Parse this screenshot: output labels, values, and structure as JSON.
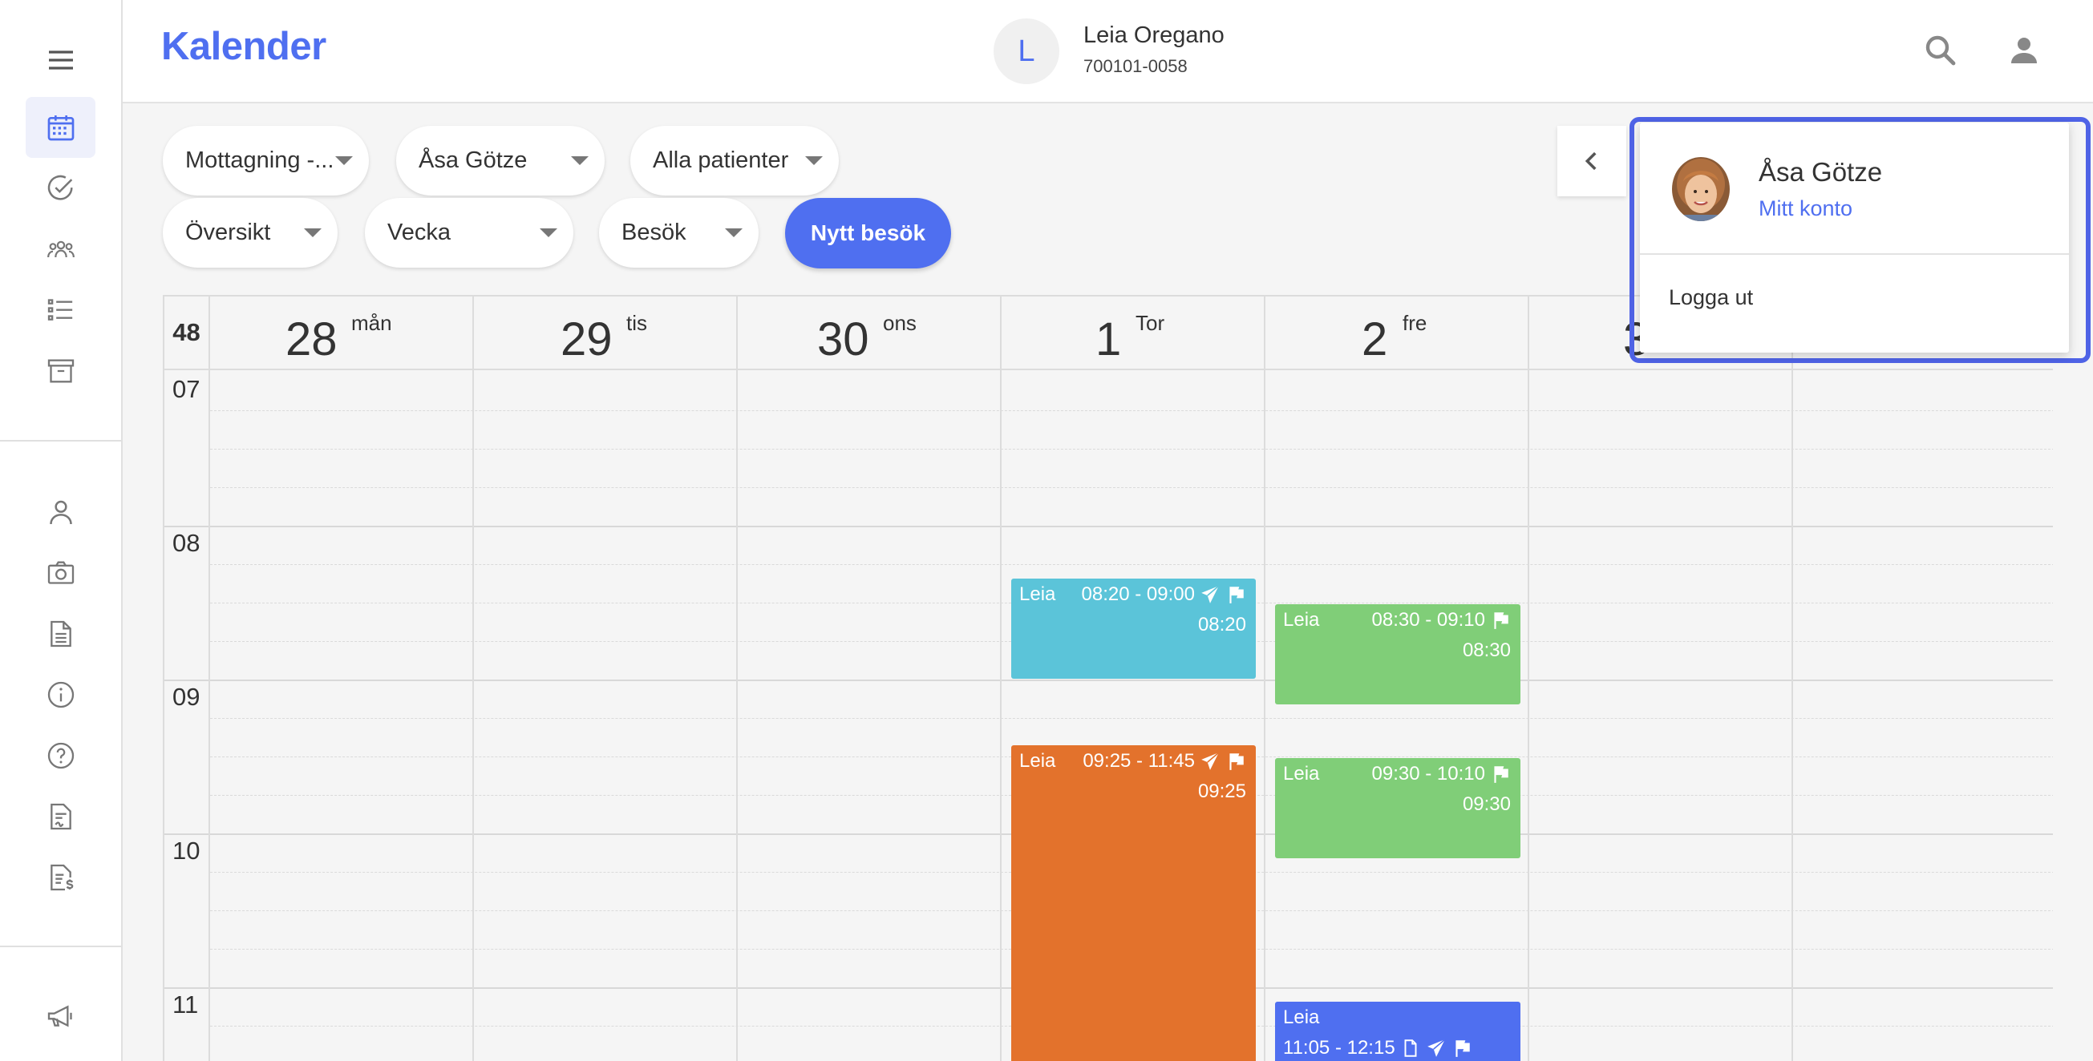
{
  "header": {
    "title": "Kalender",
    "patient": {
      "initial": "L",
      "name": "Leia Oregano",
      "personal_number": "700101-0058"
    }
  },
  "sidebar": {
    "items": [
      {
        "icon": "calendar-icon",
        "active": true
      },
      {
        "icon": "check-circle-icon"
      },
      {
        "icon": "group-icon"
      },
      {
        "icon": "list-icon"
      },
      {
        "icon": "archive-icon"
      },
      {
        "icon": "person-icon"
      },
      {
        "icon": "camera-icon"
      },
      {
        "icon": "document-icon"
      },
      {
        "icon": "info-icon"
      },
      {
        "icon": "help-icon"
      },
      {
        "icon": "signed-document-icon"
      },
      {
        "icon": "invoice-icon"
      },
      {
        "icon": "megaphone-icon"
      }
    ]
  },
  "toolbar": {
    "filters": {
      "clinic": "Mottagning -...",
      "practitioner": "Åsa Götze",
      "patients": "Alla patienter",
      "view": "Översikt",
      "range": "Vecka",
      "type": "Besök"
    },
    "new_visit_label": "Nytt besök"
  },
  "calendar": {
    "week_number": "48",
    "days": [
      {
        "num": "28",
        "name": "mån"
      },
      {
        "num": "29",
        "name": "tis"
      },
      {
        "num": "30",
        "name": "ons"
      },
      {
        "num": "1",
        "name": "Tor"
      },
      {
        "num": "2",
        "name": "fre"
      },
      {
        "num": "3",
        "name": ""
      },
      {
        "num": "",
        "name": ""
      }
    ],
    "hours": [
      "07",
      "08",
      "09",
      "10",
      "11"
    ],
    "events": [
      {
        "day": 3,
        "patient": "Leia",
        "time": "08:20 - 09:00",
        "start": "08:20",
        "color": "#5bc4d9",
        "icons": [
          "send-icon",
          "flag-icon"
        ]
      },
      {
        "day": 3,
        "patient": "Leia",
        "time": "09:25 - 11:45",
        "start": "09:25",
        "color": "#e3722c",
        "icons": [
          "send-icon",
          "flag-icon"
        ]
      },
      {
        "day": 4,
        "patient": "Leia",
        "time": "08:30 - 09:10",
        "start": "08:30",
        "color": "#80ce78",
        "icons": [
          "flag-icon"
        ]
      },
      {
        "day": 4,
        "patient": "Leia",
        "time": "09:30 - 10:10",
        "start": "09:30",
        "color": "#80ce78",
        "icons": [
          "flag-icon"
        ]
      },
      {
        "day": 4,
        "patient": "Leia",
        "time": "11:05 - 12:15",
        "start": "",
        "color": "#4f6ff0",
        "icons": [
          "document-icon",
          "send-icon",
          "flag-icon"
        ]
      }
    ]
  },
  "account_menu": {
    "user_name": "Åsa Götze",
    "account_link": "Mitt konto",
    "logout": "Logga ut"
  },
  "colors": {
    "accent": "#4f6ff0",
    "highlight_outline": "#4f63e6"
  }
}
